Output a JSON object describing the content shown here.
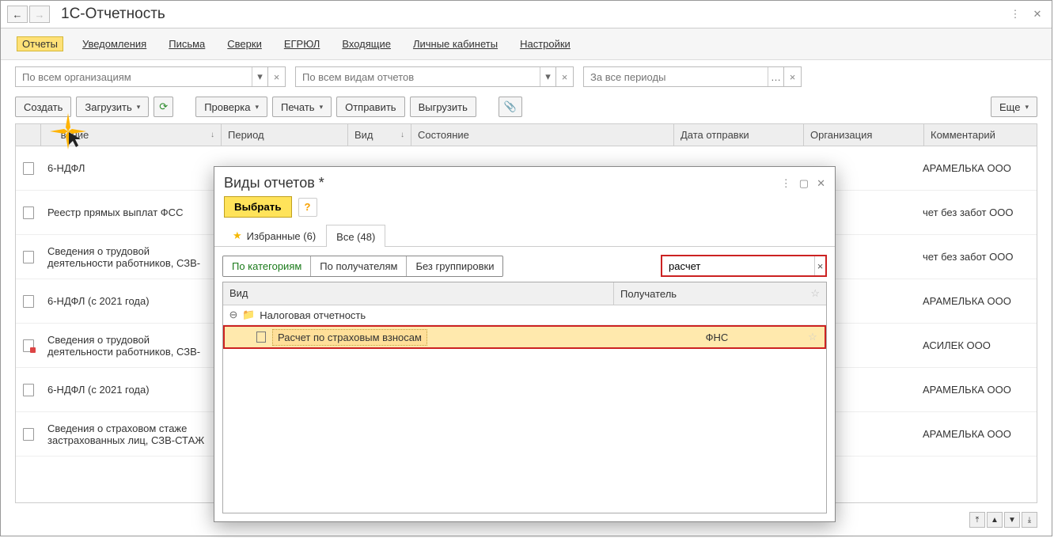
{
  "header": {
    "title": "1С-Отчетность"
  },
  "tabs": [
    "Отчеты",
    "Уведомления",
    "Письма",
    "Сверки",
    "ЕГРЮЛ",
    "Входящие",
    "Личные кабинеты",
    "Настройки"
  ],
  "activeTab": 0,
  "filters": {
    "org": "По всем организациям",
    "reportType": "По всем видам отчетов",
    "period": "За все периоды"
  },
  "toolbar": {
    "create": "Создать",
    "load": "Загрузить",
    "check": "Проверка",
    "print": "Печать",
    "send": "Отправить",
    "export": "Выгрузить",
    "more": "Еще"
  },
  "columns": {
    "name": "Наименование",
    "period": "Период",
    "type": "Вид",
    "state": "Состояние",
    "date": "Дата отправки",
    "org": "Организация",
    "comment": "Комментарий"
  },
  "nameFragment": "вание",
  "rows": [
    {
      "name": "6-НДФЛ",
      "org": "АРАМЕЛЬКА ООО"
    },
    {
      "name": "Реестр прямых выплат ФСС",
      "org": "чет без забот ООО"
    },
    {
      "name": "Сведения о трудовой деятельности работников, СЗВ-",
      "org": "чет без забот ООО"
    },
    {
      "name": "6-НДФЛ (с 2021 года)",
      "org": "АРАМЕЛЬКА ООО"
    },
    {
      "name": "Сведения о трудовой деятельности работников, СЗВ-",
      "org": "АСИЛЕК ООО",
      "red": true
    },
    {
      "name": "6-НДФЛ (с 2021 года)",
      "org": "АРАМЕЛЬКА ООО"
    },
    {
      "name": "Сведения о страховом стаже застрахованных лиц, СЗВ-СТАЖ",
      "org": "АРАМЕЛЬКА ООО"
    }
  ],
  "dialog": {
    "title": "Виды отчетов *",
    "select": "Выбрать",
    "tab1": "Избранные (6)",
    "tab2": "Все (48)",
    "activeDlgTab": 1,
    "segments": [
      "По категориям",
      "По получателям",
      "Без группировки"
    ],
    "activeSegment": 0,
    "search": "расчет",
    "gridCols": {
      "type": "Вид",
      "recipient": "Получатель"
    },
    "group": "Налоговая отчетность",
    "item": {
      "name": "Расчет по страховым взносам",
      "recipient": "ФНС"
    }
  }
}
